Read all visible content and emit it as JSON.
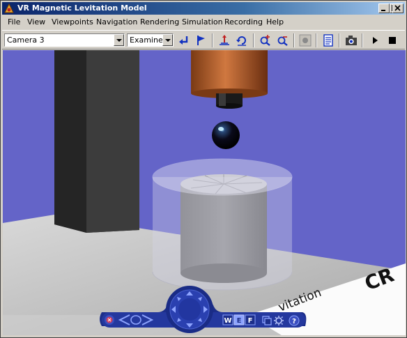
{
  "window": {
    "title": "VR Magnetic Levitation Model",
    "controls": [
      "minimize",
      "maximize",
      "close"
    ]
  },
  "menu": [
    "File",
    "View",
    "Viewpoints",
    "Navigation",
    "Rendering",
    "Simulation",
    "Recording",
    "Help"
  ],
  "toolbar": {
    "viewpoint_select": "Camera 3",
    "navigation_mode_select": "Examine",
    "buttons": [
      {
        "name": "return-to-viewpoint",
        "icon": "return-arrow-icon"
      },
      {
        "name": "create-viewpoint",
        "icon": "flag-icon"
      },
      {
        "name": "straighten-up",
        "icon": "straighten-icon"
      },
      {
        "name": "undo-move",
        "icon": "undo-move-icon"
      },
      {
        "name": "zoom-in",
        "icon": "zoom-in-icon"
      },
      {
        "name": "zoom-out",
        "icon": "zoom-out-icon"
      },
      {
        "name": "record",
        "icon": "record-icon"
      },
      {
        "name": "vrml-editor",
        "icon": "editor-icon"
      },
      {
        "name": "snapshot",
        "icon": "camera-icon"
      },
      {
        "name": "start-simulation",
        "icon": "play-icon"
      },
      {
        "name": "stop-simulation",
        "icon": "stop-icon"
      }
    ]
  },
  "scene": {
    "colors": {
      "background": "#6464c8",
      "floor": "#c8c8c8",
      "column": "#2e2e2e",
      "coil": "#b05a28",
      "ball": "#0a0a14"
    },
    "floor_labels": [
      "vitation",
      "CR"
    ]
  },
  "navigation_panel": {
    "mode_buttons": [
      "W",
      "E",
      "F"
    ],
    "icons": [
      "close-panel-icon",
      "previous-viewpoint-icon",
      "next-viewpoint-icon",
      "navigation-wheel-icon",
      "viewpoint-view-icon",
      "settings-icon",
      "help-icon"
    ]
  }
}
